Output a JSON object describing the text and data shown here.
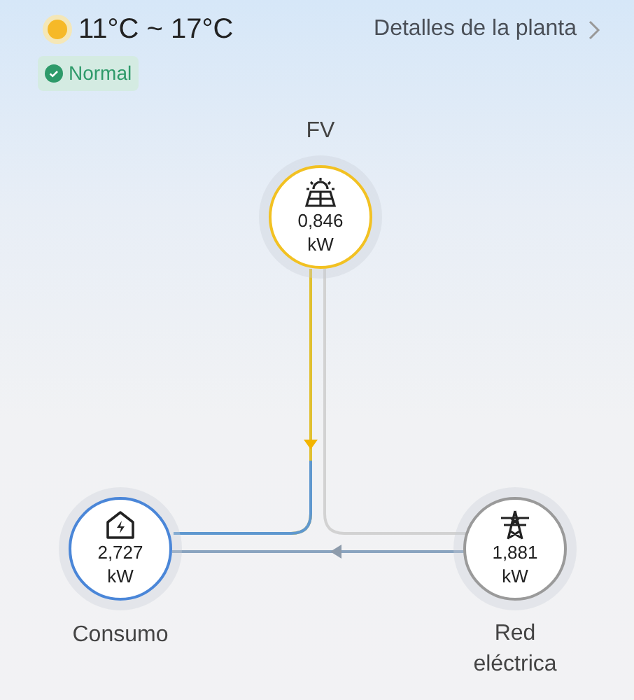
{
  "weather": {
    "temperature": "11°C ~ 17°C"
  },
  "plant_details_link": {
    "label": "Detalles de la planta"
  },
  "status": {
    "label": "Normal"
  },
  "nodes": [
    {
      "kind": "pv",
      "label": "FV",
      "value": "0,846",
      "unit": "kW",
      "color": "#f2c122"
    },
    {
      "kind": "load",
      "label": "Consumo",
      "value": "2,727",
      "unit": "kW",
      "color": "#4a86d8"
    },
    {
      "kind": "grid",
      "label": "Red eléctrica",
      "value": "1,881",
      "unit": "kW",
      "color": "#9a9a9a"
    }
  ]
}
